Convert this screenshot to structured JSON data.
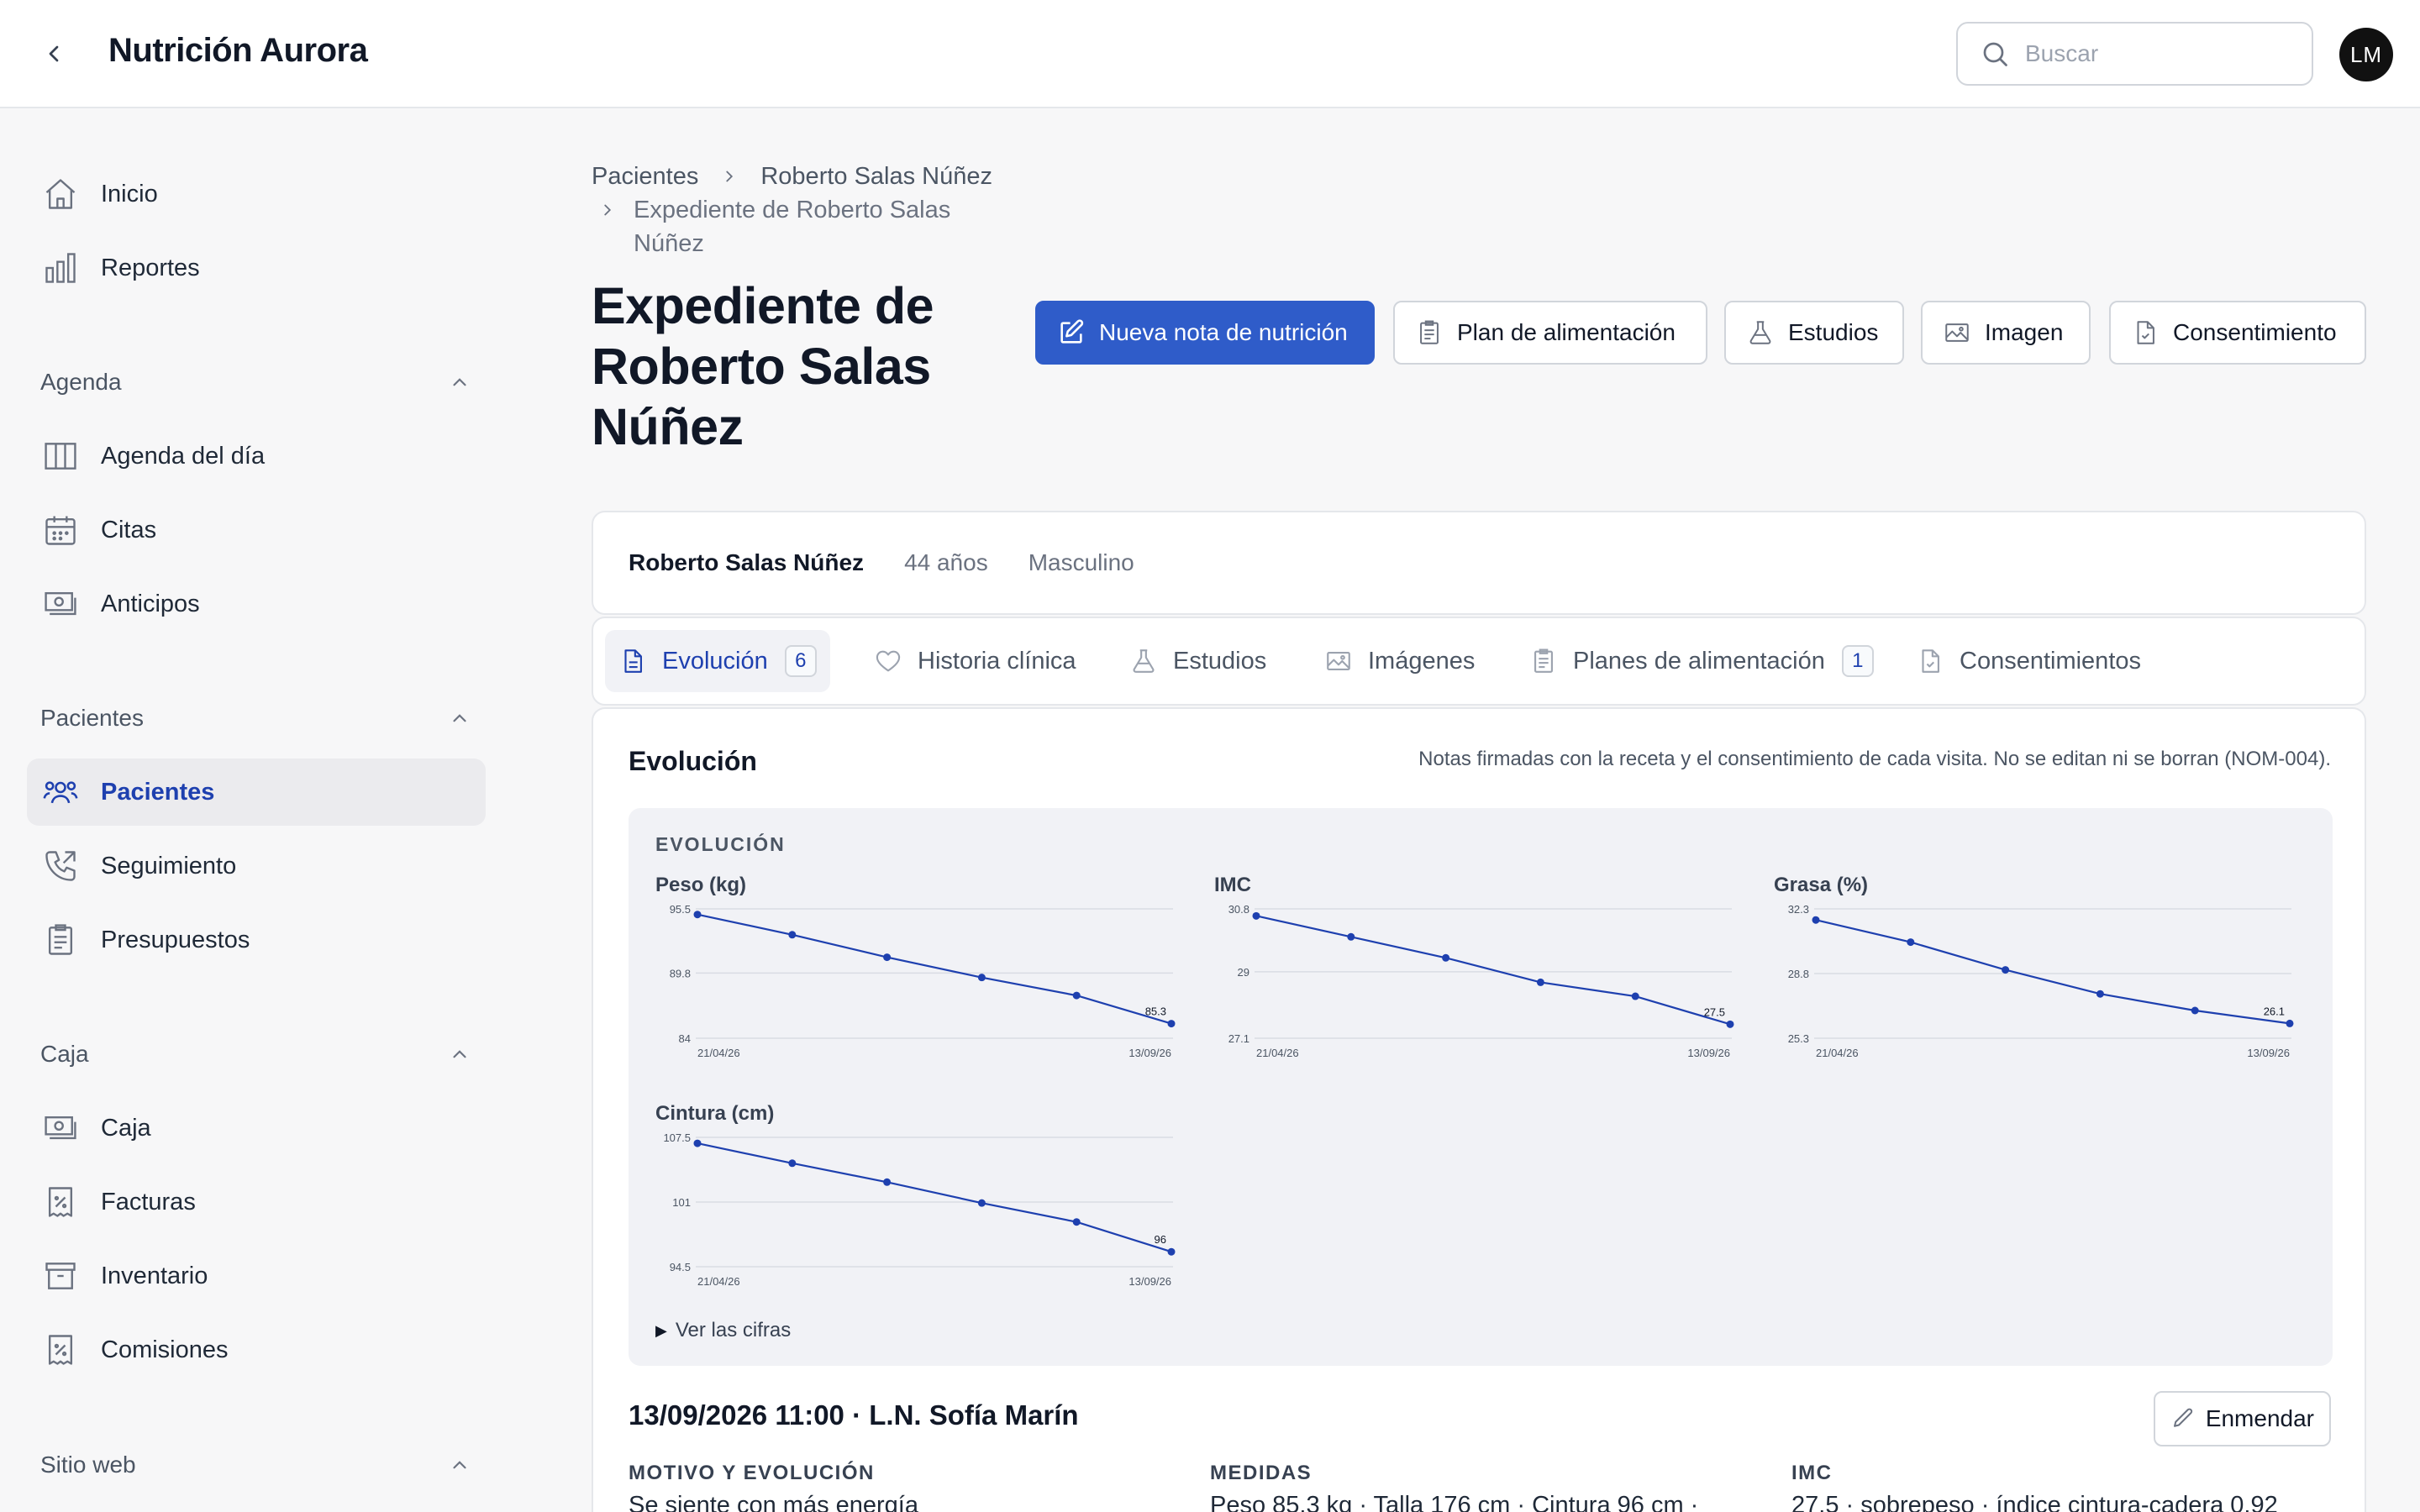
{
  "app": {
    "title": "Nutrición Aurora"
  },
  "search": {
    "placeholder": "Buscar"
  },
  "user": {
    "initials": "LM"
  },
  "sidebar": {
    "top_items": [
      {
        "label": "Inicio",
        "icon": "home-icon"
      },
      {
        "label": "Reportes",
        "icon": "bar-chart-icon"
      }
    ],
    "sections": [
      {
        "title": "Agenda",
        "items": [
          {
            "label": "Agenda del día",
            "icon": "columns-icon"
          },
          {
            "label": "Citas",
            "icon": "calendar-icon"
          },
          {
            "label": "Anticipos",
            "icon": "cash-icon"
          }
        ]
      },
      {
        "title": "Pacientes",
        "items": [
          {
            "label": "Pacientes",
            "icon": "users-icon",
            "active": true
          },
          {
            "label": "Seguimiento",
            "icon": "phone-icon"
          },
          {
            "label": "Presupuestos",
            "icon": "clipboard-icon"
          }
        ]
      },
      {
        "title": "Caja",
        "items": [
          {
            "label": "Caja",
            "icon": "cash-icon"
          },
          {
            "label": "Facturas",
            "icon": "receipt-icon"
          },
          {
            "label": "Inventario",
            "icon": "archive-icon"
          },
          {
            "label": "Comisiones",
            "icon": "receipt-icon"
          }
        ]
      },
      {
        "title": "Sitio web",
        "items": []
      }
    ]
  },
  "breadcrumb": {
    "root": "Pacientes",
    "patient": "Roberto Salas Núñez",
    "current": "Expediente de Roberto Salas Núñez"
  },
  "page": {
    "title": "Expediente de Roberto Salas Núñez"
  },
  "actions": {
    "new_note": "Nueva nota de nutrición",
    "meal_plan": "Plan de alimentación",
    "studies": "Estudios",
    "image": "Imagen",
    "consent": "Consentimiento"
  },
  "patient": {
    "name": "Roberto Salas Núñez",
    "age": "44 años",
    "sex": "Masculino"
  },
  "tabs": [
    {
      "label": "Evolución",
      "count": "6",
      "active": true
    },
    {
      "label": "Historia clínica"
    },
    {
      "label": "Estudios"
    },
    {
      "label": "Imágenes"
    },
    {
      "label": "Planes de alimentación",
      "count": "1"
    },
    {
      "label": "Consentimientos"
    }
  ],
  "evolution": {
    "title": "Evolución",
    "note": "Notas firmadas con la receta y el consentimiento de cada visita. No se editan ni se borran (NOM-004).",
    "charts_heading": "EVOLUCIÓN",
    "show_figures": "Ver las cifras"
  },
  "chart_data": [
    {
      "type": "line",
      "title": "Peso (kg)",
      "yticks": [
        "95.5",
        "89.8",
        "84"
      ],
      "ylim": [
        84,
        95.5
      ],
      "x_labels": [
        "21/04/26",
        "13/09/26"
      ],
      "values": [
        95.0,
        93.2,
        91.2,
        89.4,
        87.8,
        85.3
      ],
      "last_label": "85.3",
      "color": "#1e40af"
    },
    {
      "type": "line",
      "title": "IMC",
      "yticks": [
        "30.8",
        "29",
        "27.1"
      ],
      "ylim": [
        27.1,
        30.8
      ],
      "x_labels": [
        "21/04/26",
        "13/09/26"
      ],
      "values": [
        30.6,
        30.0,
        29.4,
        28.7,
        28.3,
        27.5
      ],
      "last_label": "27.5",
      "color": "#1e40af"
    },
    {
      "type": "line",
      "title": "Grasa (%)",
      "yticks": [
        "32.3",
        "28.8",
        "25.3"
      ],
      "ylim": [
        25.3,
        32.3
      ],
      "x_labels": [
        "21/04/26",
        "13/09/26"
      ],
      "values": [
        31.7,
        30.5,
        29.0,
        27.7,
        26.8,
        26.1
      ],
      "last_label": "26.1",
      "color": "#1e40af"
    },
    {
      "type": "line",
      "title": "Cintura (cm)",
      "yticks": [
        "107.5",
        "101",
        "94.5"
      ],
      "ylim": [
        94.5,
        107.5
      ],
      "x_labels": [
        "21/04/26",
        "13/09/26"
      ],
      "values": [
        106.9,
        104.9,
        103.0,
        100.9,
        99.0,
        96.0
      ],
      "last_label": "96",
      "color": "#1e40af"
    }
  ],
  "entry": {
    "header": "13/09/2026 11:00 · L.N. Sofía Marín",
    "amend": "Enmendar",
    "cols": [
      {
        "head": "MOTIVO Y EVOLUCIÓN",
        "text": "Se siente con más energía"
      },
      {
        "head": "MEDIDAS",
        "text": "Peso 85.3 kg · Talla 176 cm · Cintura 96 cm ·"
      },
      {
        "head": "IMC",
        "text": "27.5 · sobrepeso · índice cintura-cadera 0.92"
      }
    ]
  }
}
